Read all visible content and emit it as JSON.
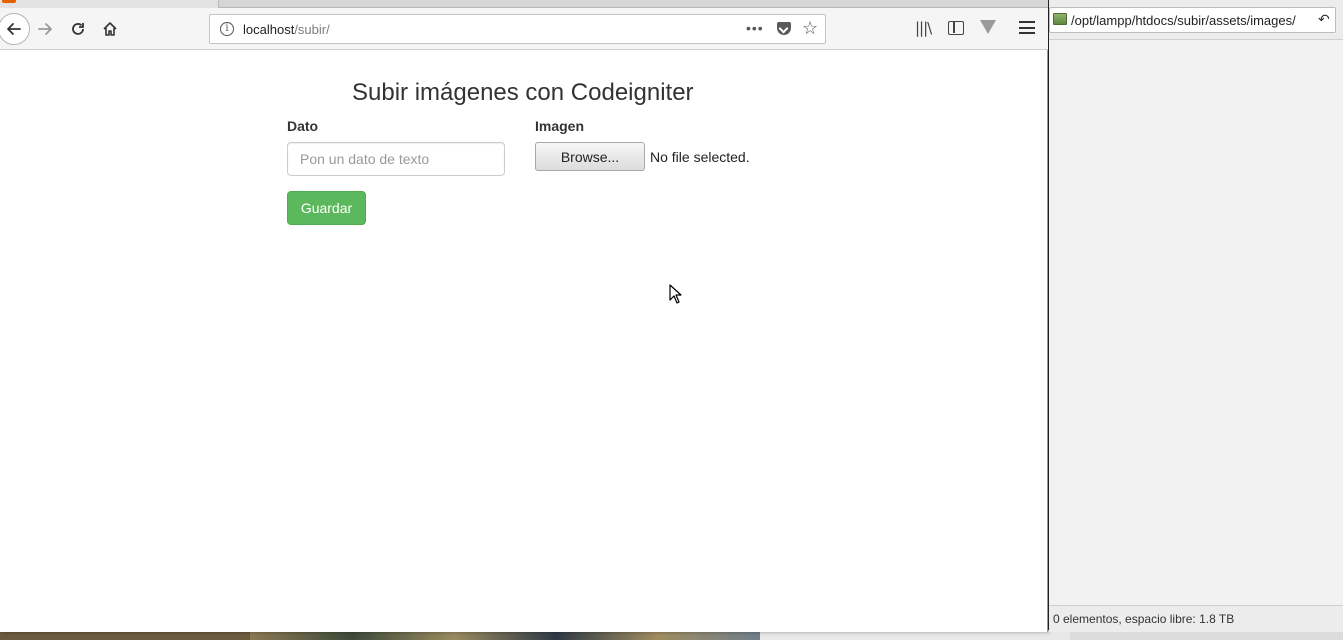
{
  "browser": {
    "url_host": "localhost",
    "url_path": "/subir/"
  },
  "page": {
    "title": "Subir imágenes con Codeigniter",
    "dato_label": "Dato",
    "dato_placeholder": "Pon un dato de texto",
    "imagen_label": "Imagen",
    "browse_label": "Browse...",
    "file_status": "No file selected.",
    "guardar_label": "Guardar"
  },
  "file_manager": {
    "path": "/opt/lampp/htdocs/subir/assets/images/",
    "status": "0 elementos, espacio libre: 1.8 TB"
  },
  "colors": {
    "primary_green": "#5cb85c",
    "toolbar_bg": "#f5f5f5"
  }
}
